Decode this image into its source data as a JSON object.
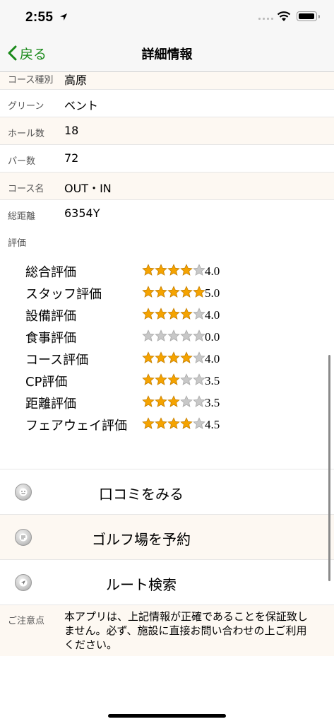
{
  "status_bar": {
    "time": "2:55"
  },
  "nav": {
    "back_label": "戻る",
    "title": "詳細情報"
  },
  "info_rows": [
    {
      "label": "コース種別",
      "value": "高原"
    },
    {
      "label": "グリーン",
      "value": "ベント"
    },
    {
      "label": "ホール数",
      "value": "18"
    },
    {
      "label": "パー数",
      "value": "72"
    },
    {
      "label": "コース名",
      "value": "OUT・IN"
    },
    {
      "label": "総距離",
      "value": "6354Y"
    }
  ],
  "evaluation": {
    "heading": "評価",
    "ratings": [
      {
        "label": "総合評価",
        "stars": 4,
        "value": "4.0"
      },
      {
        "label": "スタッフ評価",
        "stars": 5,
        "value": "5.0"
      },
      {
        "label": "設備評価",
        "stars": 4,
        "value": "4.0"
      },
      {
        "label": "食事評価",
        "stars": 0,
        "value": "0.0"
      },
      {
        "label": "コース評価",
        "stars": 4,
        "value": "4.0"
      },
      {
        "label": "CP評価",
        "stars": 3,
        "value": "3.5"
      },
      {
        "label": "距離評価",
        "stars": 3,
        "value": "3.5"
      },
      {
        "label": "フェアウェイ評価",
        "stars": 4,
        "value": "4.5"
      }
    ]
  },
  "actions": [
    {
      "label": "口コミをみる",
      "icon": "smiley-icon"
    },
    {
      "label": "ゴルフ場を予約",
      "icon": "keypad-icon"
    },
    {
      "label": "ルート検索",
      "icon": "navigation-arrow-icon"
    }
  ],
  "notice": {
    "label": "ご注意点",
    "text": "本アプリは、上記情報が正確であることを保証致しません。必ず、施設に直接お問い合わせの上ご利用ください。"
  },
  "colors": {
    "accent": "#1a8a1a",
    "row_alt": "#fdf8f2",
    "star_filled": "#f5a300",
    "star_empty": "#c8c8c8"
  }
}
